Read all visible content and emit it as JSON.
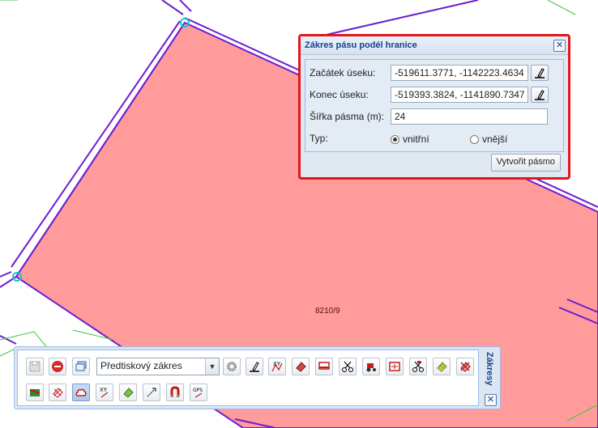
{
  "map": {
    "parcel_label": "8210/9",
    "parcel_fill": "#ff9b9b",
    "boundary_color": "#6e1fd1",
    "line_color": "#3cc63c"
  },
  "dialog": {
    "title": "Zákres pásu podél hranice",
    "close_label": "✕",
    "start_label": "Začátek úseku:",
    "start_value": "-519611.3771, -1142223.4634",
    "end_label": "Konec úseku:",
    "end_value": "-519393.3824, -1141890.7347",
    "width_label": "Šířka pásma (m):",
    "width_value": "24",
    "type_label": "Typ:",
    "type_options": [
      "vnitřní",
      "vnější"
    ],
    "type_selected": "vnitřní",
    "create_label": "Vytvořit pásmo",
    "border_color": "#e3161b"
  },
  "toolbar": {
    "title": "Zákresy",
    "close_label": "✕",
    "select_value": "Předtiskový zákres",
    "xy_label": "XY",
    "gps_label": "GPS"
  }
}
